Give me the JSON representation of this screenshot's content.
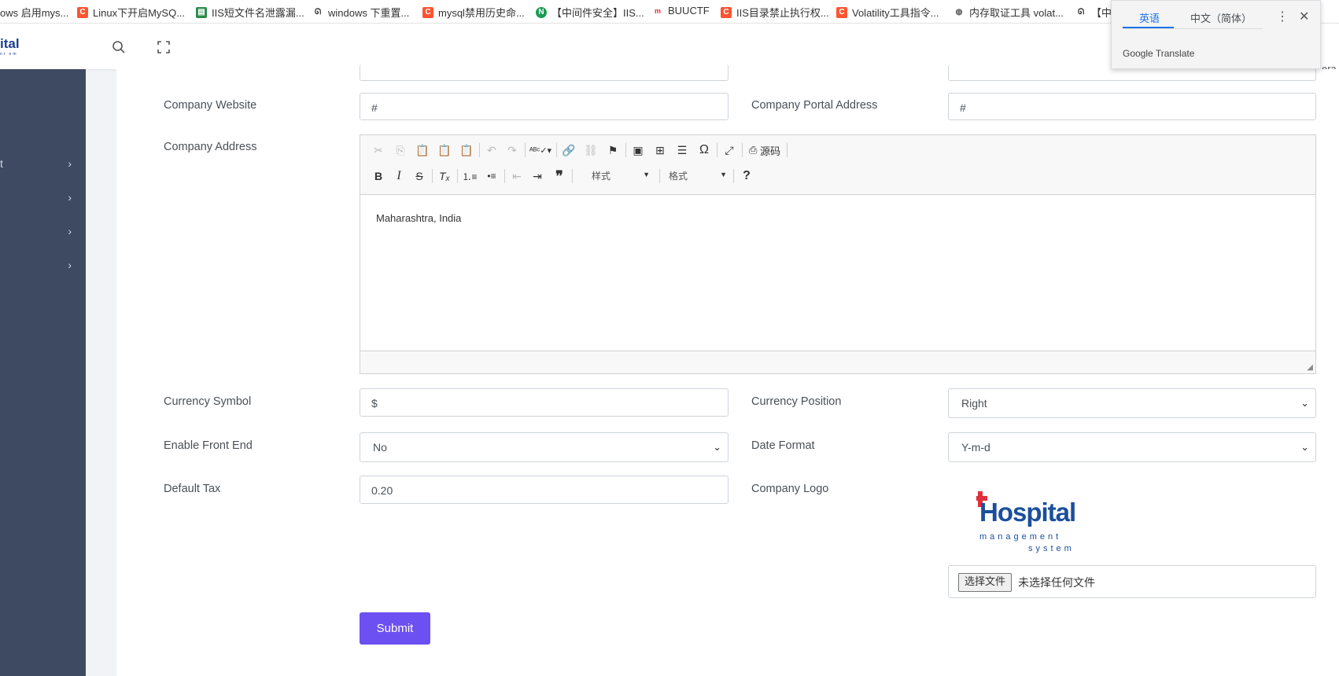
{
  "bookmarks": [
    {
      "label": "ows 启用mys...",
      "icon": "page-icon",
      "color": "#ffffff"
    },
    {
      "label": "Linux下开启MySQ...",
      "icon": "csdn-icon",
      "color": "#fc5531"
    },
    {
      "label": "IIS短文件名泄露漏...",
      "icon": "sheet-icon",
      "color": "#2a8b4b"
    },
    {
      "label": "windows 下重置...",
      "icon": "feather-icon",
      "color": "#333333"
    },
    {
      "label": "mysql禁用历史命...",
      "icon": "csdn-icon",
      "color": "#fc5531"
    },
    {
      "label": "【中间件安全】IIS...",
      "icon": "n-icon",
      "color": "#1a9c53"
    },
    {
      "label": "BUUCTF",
      "icon": "m-icon",
      "color": "#e0303b"
    },
    {
      "label": "IIS目录禁止执行权...",
      "icon": "csdn-icon",
      "color": "#fc5531"
    },
    {
      "label": "Volatility工具指令...",
      "icon": "csdn-icon",
      "color": "#fc5531"
    },
    {
      "label": "内存取证工具 volat...",
      "icon": "globe-icon",
      "color": "#555555"
    },
    {
      "label": "【中",
      "icon": "feather-icon",
      "color": "#333333"
    }
  ],
  "topbar": {
    "brand": "ital",
    "brand_sub": "nt\nem"
  },
  "translate": {
    "tab_en": "英语",
    "tab_zh": "中文（简体）",
    "brand_google": "Google",
    "brand_translate": "Translate",
    "cut": "era"
  },
  "sidebar": {
    "items": [
      {
        "label": "t",
        "chevron": "›"
      },
      {
        "label": "",
        "chevron": "›"
      },
      {
        "label": "",
        "chevron": "›"
      },
      {
        "label": "",
        "chevron": "›"
      }
    ]
  },
  "form": {
    "website_label": "Company Website",
    "website_value": "#",
    "portal_label": "Company Portal Address",
    "portal_value": "#",
    "address_label": "Company Address",
    "address_value": "Maharashtra, India",
    "currency_symbol_label": "Currency Symbol",
    "currency_symbol_value": "$",
    "currency_position_label": "Currency Position",
    "currency_position_value": "Right",
    "front_end_label": "Enable Front End",
    "front_end_value": "No",
    "date_format_label": "Date Format",
    "date_format_value": "Y-m-d",
    "default_tax_label": "Default Tax",
    "default_tax_value": "0.20",
    "logo_label": "Company Logo",
    "logo_text_main": "Hospital",
    "logo_text_sub1": "management",
    "logo_text_sub2": "system",
    "file_button": "选择文件",
    "file_status": "未选择任何文件",
    "submit": "Submit"
  },
  "editor": {
    "source_label": "源码",
    "styles_label": "样式",
    "format_label": "格式",
    "help": "?"
  }
}
